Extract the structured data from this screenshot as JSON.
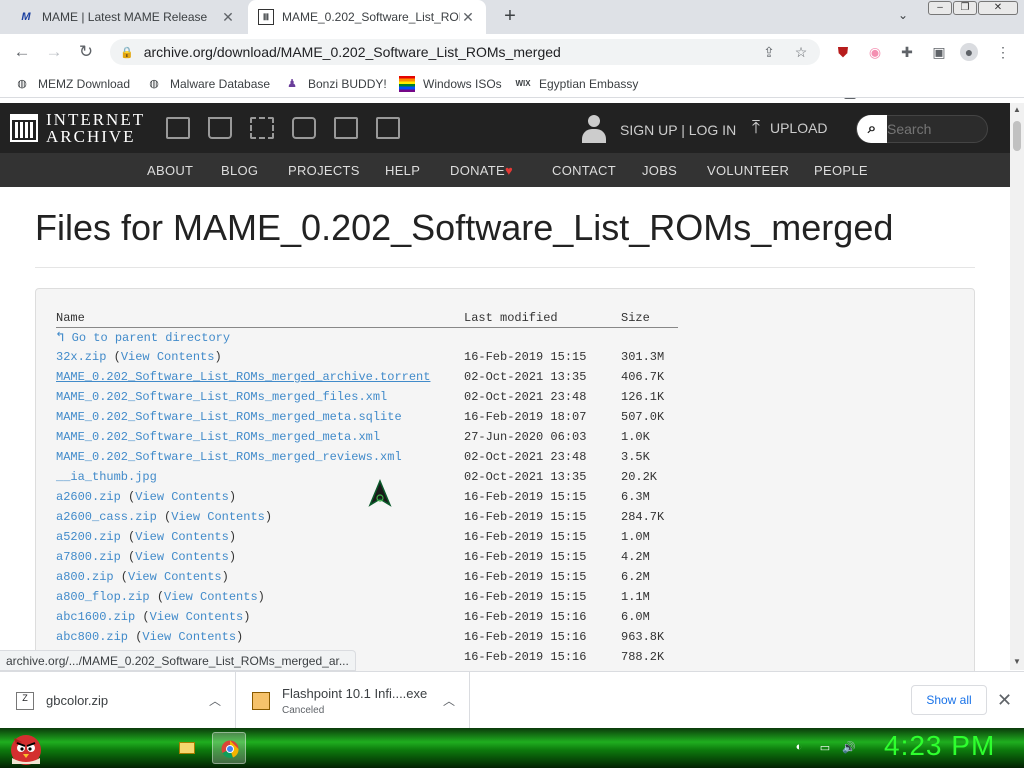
{
  "tabs": [
    {
      "title": "MAME | Latest MAME Release",
      "active": false,
      "favicon": "mame-logo-icon"
    },
    {
      "title": "MAME_0.202_Software_List_ROM",
      "active": true,
      "favicon": "internet-archive-icon"
    }
  ],
  "url": "archive.org/download/MAME_0.202_Software_List_ROMs_merged",
  "extension_badge": "4",
  "bookmarks": [
    {
      "label": "MEMZ Download",
      "icon": "globe-icon"
    },
    {
      "label": "Malware Database",
      "icon": "globe-icon"
    },
    {
      "label": "Bonzi BUDDY!",
      "icon": "bonzi-icon"
    },
    {
      "label": "Windows ISOs",
      "icon": "rainbow-flag-icon"
    },
    {
      "label": "Egyptian Embassy",
      "icon": "wix-icon"
    }
  ],
  "ia": {
    "logo_line1": "INTERNET",
    "logo_line2": "ARCHIVE",
    "signin": "SIGN UP | LOG IN",
    "upload": "UPLOAD",
    "search_placeholder": "Search",
    "nav": [
      "ABOUT",
      "BLOG",
      "PROJECTS",
      "HELP",
      "DONATE",
      "CONTACT",
      "JOBS",
      "VOLUNTEER",
      "PEOPLE"
    ],
    "donate_heart": "♥"
  },
  "page": {
    "title": "Files for MAME_0.202_Software_List_ROMs_merged",
    "columns": [
      "Name",
      "Last modified",
      "Size"
    ],
    "parent_link": "Go to parent directory",
    "view_contents": "View Contents",
    "files": [
      {
        "name": "32x.zip",
        "view": true,
        "modified": "16-Feb-2019 15:15",
        "size": "301.3M",
        "underline": false
      },
      {
        "name": "MAME_0.202_Software_List_ROMs_merged_archive.torrent",
        "view": false,
        "modified": "02-Oct-2021 13:35",
        "size": "406.7K",
        "underline": true
      },
      {
        "name": "MAME_0.202_Software_List_ROMs_merged_files.xml",
        "view": false,
        "modified": "02-Oct-2021 23:48",
        "size": "126.1K",
        "underline": false
      },
      {
        "name": "MAME_0.202_Software_List_ROMs_merged_meta.sqlite",
        "view": false,
        "modified": "16-Feb-2019 18:07",
        "size": "507.0K",
        "underline": false
      },
      {
        "name": "MAME_0.202_Software_List_ROMs_merged_meta.xml",
        "view": false,
        "modified": "27-Jun-2020 06:03",
        "size": "1.0K",
        "underline": false
      },
      {
        "name": "MAME_0.202_Software_List_ROMs_merged_reviews.xml",
        "view": false,
        "modified": "02-Oct-2021 23:48",
        "size": "3.5K",
        "underline": false
      },
      {
        "name": "__ia_thumb.jpg",
        "view": false,
        "modified": "02-Oct-2021 13:35",
        "size": "20.2K",
        "underline": false
      },
      {
        "name": "a2600.zip",
        "view": true,
        "modified": "16-Feb-2019 15:15",
        "size": "6.3M",
        "underline": false
      },
      {
        "name": "a2600_cass.zip",
        "view": true,
        "modified": "16-Feb-2019 15:15",
        "size": "284.7K",
        "underline": false
      },
      {
        "name": "a5200.zip",
        "view": true,
        "modified": "16-Feb-2019 15:15",
        "size": "1.0M",
        "underline": false
      },
      {
        "name": "a7800.zip",
        "view": true,
        "modified": "16-Feb-2019 15:15",
        "size": "4.2M",
        "underline": false
      },
      {
        "name": "a800.zip",
        "view": true,
        "modified": "16-Feb-2019 15:15",
        "size": "6.2M",
        "underline": false
      },
      {
        "name": "a800_flop.zip",
        "view": true,
        "modified": "16-Feb-2019 15:15",
        "size": "1.1M",
        "underline": false
      },
      {
        "name": "abc1600.zip",
        "view": true,
        "modified": "16-Feb-2019 15:16",
        "size": "6.0M",
        "underline": false
      },
      {
        "name": "abc800.zip",
        "view": true,
        "modified": "16-Feb-2019 15:16",
        "size": "963.8K",
        "underline": false
      },
      {
        "name": "",
        "view": false,
        "modified": "16-Feb-2019 15:16",
        "size": "788.2K",
        "underline": false
      }
    ]
  },
  "status_bar": "archive.org/.../MAME_0.202_Software_List_ROMs_merged_ar...",
  "downloads": [
    {
      "name": "gbcolor.zip",
      "status": ""
    },
    {
      "name": "Flashpoint 10.1 Infi....exe",
      "status": "Canceled"
    }
  ],
  "show_all": "Show all",
  "clock": "4:23 PM",
  "colors": {
    "link": "#428bca",
    "ia_header": "#222222",
    "ia_nav": "#333333",
    "clock": "#2eff2e",
    "taskbar": "#1fae1f"
  }
}
